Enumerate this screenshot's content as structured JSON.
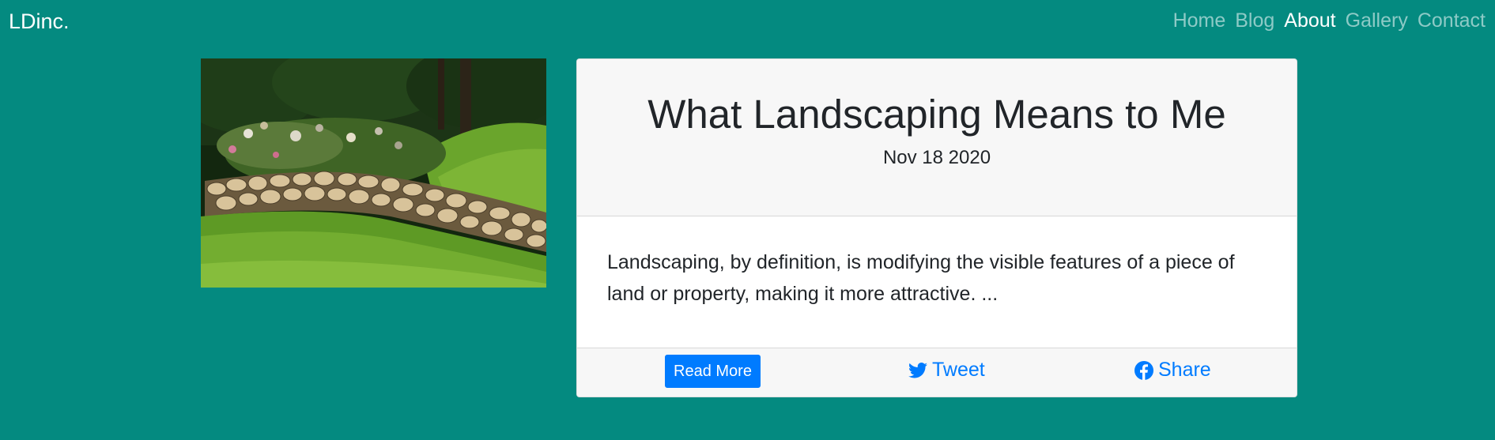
{
  "navbar": {
    "brand": "LDinc.",
    "links": [
      {
        "label": "Home",
        "active": false
      },
      {
        "label": "Blog",
        "active": false
      },
      {
        "label": "About",
        "active": true
      },
      {
        "label": "Gallery",
        "active": false
      },
      {
        "label": "Contact",
        "active": false
      }
    ]
  },
  "post": {
    "title": "What Landscaping Means to Me",
    "date": "Nov 18 2020",
    "excerpt": "Landscaping, by definition, is modifying the visible features of a piece of land or property, making it more attractive.  ...",
    "read_more_label": "Read More",
    "tweet_label": "Tweet",
    "share_label": "Share",
    "tweet_icon": "twitter-icon",
    "share_icon": "facebook-icon"
  },
  "colors": {
    "page_background": "#048a80",
    "accent": "#007bff",
    "card_header_background": "#f7f7f7"
  }
}
